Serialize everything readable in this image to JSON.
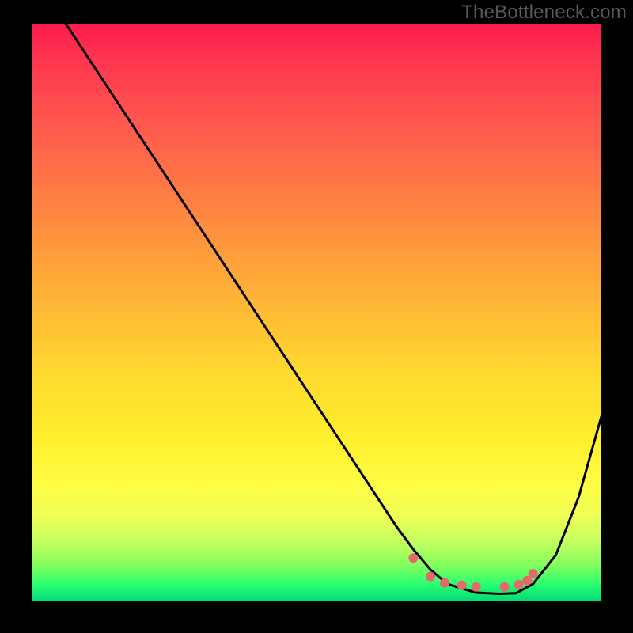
{
  "watermark": "TheBottleneck.com",
  "chart_data": {
    "type": "line",
    "title": "",
    "xlabel": "",
    "ylabel": "",
    "xlim": [
      0,
      100
    ],
    "ylim": [
      0,
      100
    ],
    "grid": false,
    "series": [
      {
        "name": "curve",
        "color": "#000000",
        "x": [
          6,
          10,
          16,
          22,
          28,
          34,
          40,
          46,
          52,
          58,
          64,
          67,
          70,
          73,
          78,
          82,
          85,
          88,
          92,
          96,
          100
        ],
        "y": [
          100,
          94,
          85,
          76,
          67,
          58,
          49,
          40,
          31,
          22,
          13,
          9,
          5.5,
          3,
          1.5,
          1.3,
          1.4,
          3,
          8,
          18,
          32
        ]
      },
      {
        "name": "dots",
        "color": "#e46a6a",
        "x": [
          67,
          70,
          72.5,
          75.5,
          78,
          83,
          85.5,
          87,
          88
        ],
        "y": [
          7.5,
          4.3,
          3.2,
          2.8,
          2.5,
          2.5,
          2.9,
          3.6,
          4.8
        ]
      }
    ],
    "gradient_stops": [
      {
        "pos": 0,
        "color": "#ff1a4d"
      },
      {
        "pos": 18,
        "color": "#ff5a4e"
      },
      {
        "pos": 48,
        "color": "#ffb536"
      },
      {
        "pos": 72,
        "color": "#fff02c"
      },
      {
        "pos": 90,
        "color": "#c0ff5f"
      },
      {
        "pos": 100,
        "color": "#00d977"
      }
    ]
  }
}
